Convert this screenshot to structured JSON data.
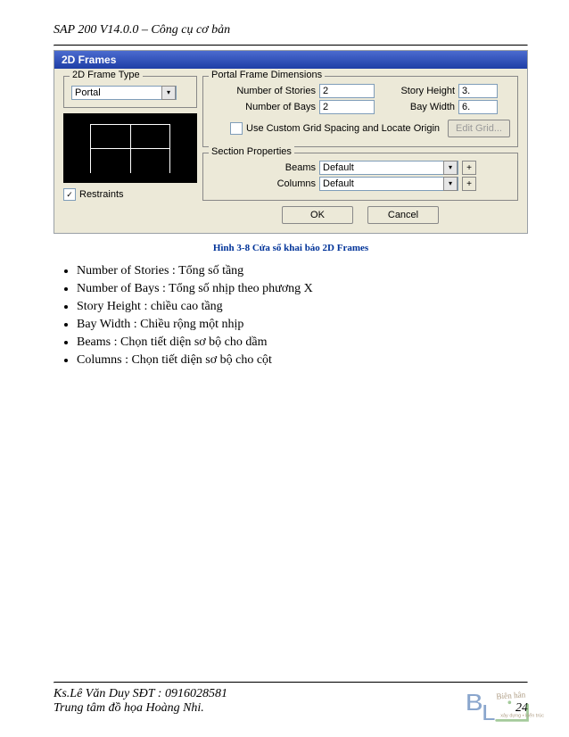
{
  "header": {
    "title": "SAP 200 V14.0.0 – Công cụ cơ bản"
  },
  "dialog": {
    "title": "2D Frames",
    "frame_type_legend": "2D Frame Type",
    "frame_type_value": "Portal",
    "restraints_label": "Restraints",
    "dimensions": {
      "legend": "Portal Frame Dimensions",
      "stories_label": "Number of Stories",
      "stories_value": "2",
      "bays_label": "Number of Bays",
      "bays_value": "2",
      "story_height_label": "Story Height",
      "story_height_value": "3.",
      "bay_width_label": "Bay Width",
      "bay_width_value": "6.",
      "grid_checkbox_label": "Use Custom Grid Spacing and Locate Origin",
      "edit_grid_label": "Edit Grid..."
    },
    "section": {
      "legend": "Section Properties",
      "beams_label": "Beams",
      "beams_value": "Default",
      "columns_label": "Columns",
      "columns_value": "Default",
      "plus": "+"
    },
    "buttons": {
      "ok": "OK",
      "cancel": "Cancel"
    }
  },
  "caption": "Hình 3-8 Cửa sổ khai báo 2D Frames",
  "bullets": [
    "Number of Stories : Tổng số tầng",
    "Number of Bays : Tổng số nhịp theo phương X",
    "Story Height : chiều cao tầng",
    "Bay Width : Chiều rộng một nhịp",
    "Beams : Chọn tiết diện sơ bộ cho dầm",
    "Columns : Chọn tiết diện sơ bộ cho cột"
  ],
  "footer": {
    "line1": "Ks.Lê Văn Duy SĐT : 0916028581",
    "line2": "Trung tâm đồ họa Hoàng Nhi.",
    "pagenum": "24"
  }
}
